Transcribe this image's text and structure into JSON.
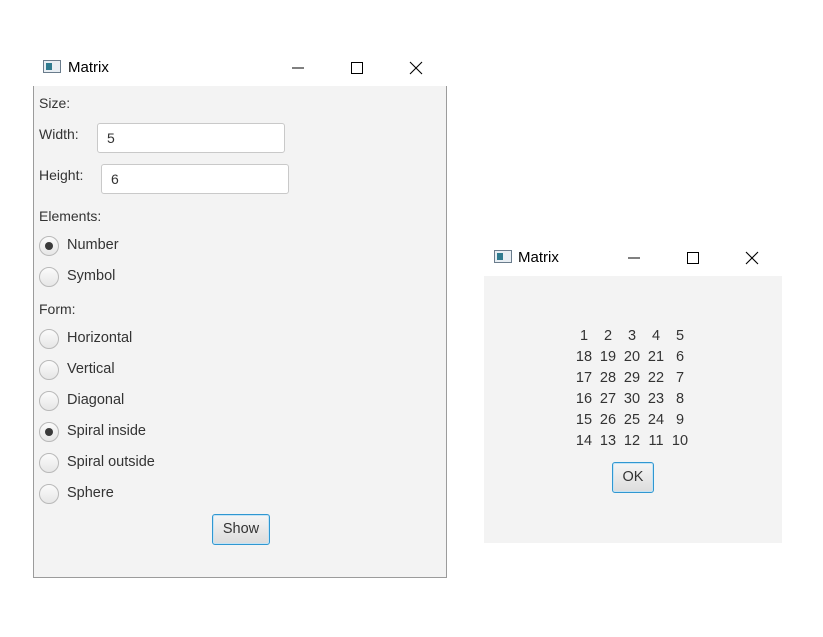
{
  "main_window": {
    "title": "Matrix",
    "size_label": "Size:",
    "width_label": "Width:",
    "width_value": "5",
    "height_label": "Height:",
    "height_value": "6",
    "elements_label": "Elements:",
    "elements_options": [
      {
        "label": "Number",
        "selected": true
      },
      {
        "label": "Symbol",
        "selected": false
      }
    ],
    "form_label": "Form:",
    "form_options": [
      {
        "label": "Horizontal",
        "selected": false
      },
      {
        "label": "Vertical",
        "selected": false
      },
      {
        "label": "Diagonal",
        "selected": false
      },
      {
        "label": "Spiral inside",
        "selected": true
      },
      {
        "label": "Spiral outside",
        "selected": false
      },
      {
        "label": "Sphere",
        "selected": false
      }
    ],
    "show_button": "Show"
  },
  "result_window": {
    "title": "Matrix",
    "matrix": [
      [
        "1",
        "2",
        "3",
        "4",
        "5"
      ],
      [
        "18",
        "19",
        "20",
        "21",
        "6"
      ],
      [
        "17",
        "28",
        "29",
        "22",
        "7"
      ],
      [
        "16",
        "27",
        "30",
        "23",
        "8"
      ],
      [
        "15",
        "26",
        "25",
        "24",
        "9"
      ],
      [
        "14",
        "13",
        "12",
        "11",
        "10"
      ]
    ],
    "ok_button": "OK"
  },
  "icons": {
    "app": "app-window-icon",
    "minimize": "minimize-icon",
    "maximize": "maximize-icon",
    "close": "close-icon"
  },
  "colors": {
    "client_bg": "#f3f3f3",
    "focus_border": "#2f97d1",
    "radio_dot": "#3a3a3a"
  }
}
